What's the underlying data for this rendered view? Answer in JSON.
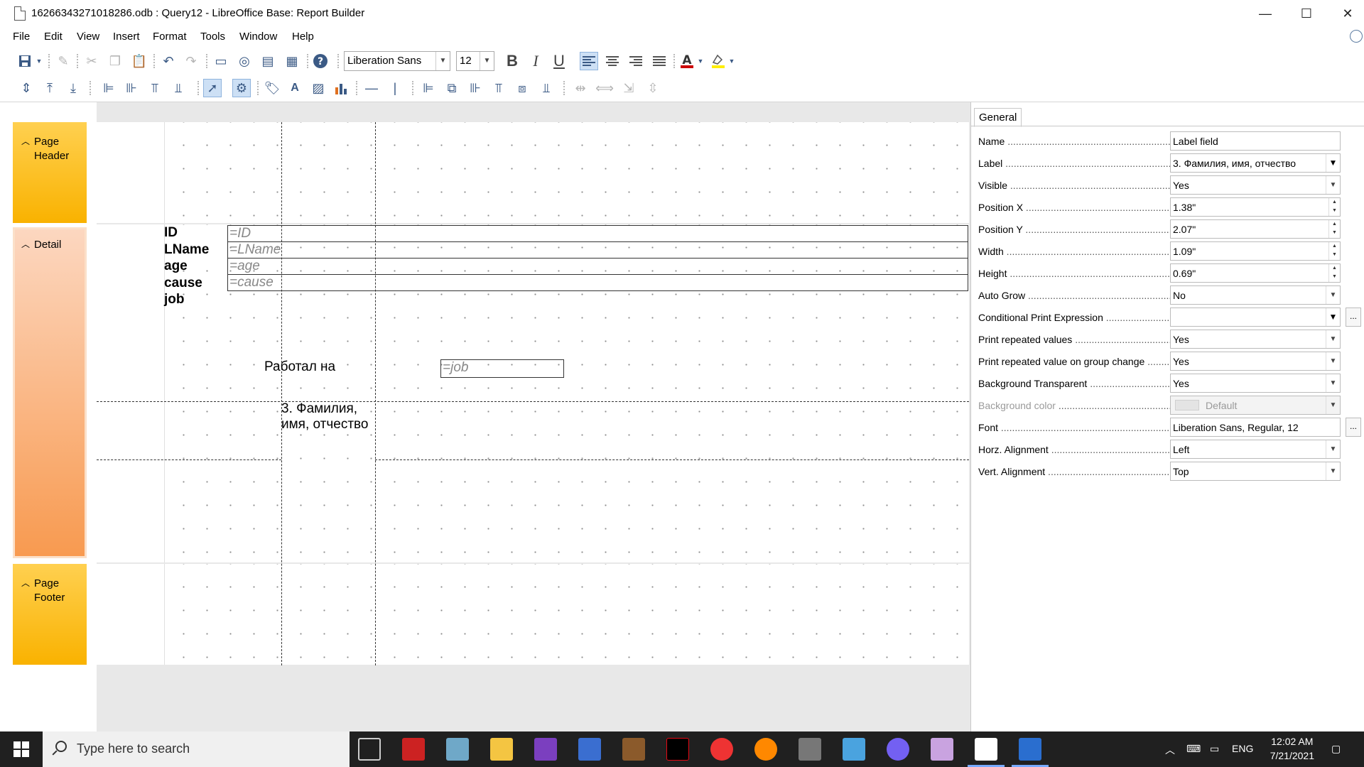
{
  "window": {
    "title": "16266343271018286.odb : Query12 - LibreOffice Base: Report Builder",
    "minimize": "—",
    "maximize": "☐",
    "close": "✕"
  },
  "menu": [
    "File",
    "Edit",
    "View",
    "Insert",
    "Format",
    "Tools",
    "Window",
    "Help"
  ],
  "toolbar": {
    "font_name": "Liberation Sans",
    "font_size": "12",
    "bold": "B",
    "italic": "I",
    "underline": "U",
    "font_color": "#cc0000",
    "highlight_color": "#ffee00"
  },
  "sections": {
    "page_header": [
      "Page",
      "Header"
    ],
    "detail": "Detail",
    "page_footer": [
      "Page",
      "Footer"
    ],
    "colors": {
      "header_top": "#ffd050",
      "header_bottom": "#f9b200",
      "detail_top": "#fcd7c0",
      "detail_bottom": "#f89a50"
    }
  },
  "report": {
    "labels": [
      "ID",
      "LName",
      "age",
      "cause",
      "job"
    ],
    "fields": [
      "=ID",
      "=LName",
      "=age",
      "=cause"
    ],
    "worked_label": "Работал на",
    "job_field": "=job",
    "selected_label": [
      "3. Фамилия,",
      "имя, отчество"
    ]
  },
  "properties": {
    "tab": "General",
    "rows": [
      {
        "name": "Name",
        "value": "Label field",
        "kind": "text"
      },
      {
        "name": "Label",
        "value": "3. Фамилия, имя, отчество",
        "kind": "dropdown-solid"
      },
      {
        "name": "Visible",
        "value": "Yes",
        "kind": "dropdown"
      },
      {
        "name": "Position X",
        "value": "1.38\"",
        "kind": "spin"
      },
      {
        "name": "Position Y",
        "value": "2.07\"",
        "kind": "spin"
      },
      {
        "name": "Width",
        "value": "1.09\"",
        "kind": "spin"
      },
      {
        "name": "Height",
        "value": "0.69\"",
        "kind": "spin"
      },
      {
        "name": "Auto Grow",
        "value": "No",
        "kind": "dropdown"
      },
      {
        "name": "Conditional Print Expression",
        "value": "",
        "kind": "dropdown-solid-btn"
      },
      {
        "name": "Print repeated values",
        "value": "Yes",
        "kind": "dropdown"
      },
      {
        "name": "Print repeated value on group change",
        "value": "Yes",
        "kind": "dropdown"
      },
      {
        "name": "Background Transparent",
        "value": "Yes",
        "kind": "dropdown"
      },
      {
        "name": "Background color",
        "value": "Default",
        "kind": "disabled"
      },
      {
        "name": "Font",
        "value": "Liberation Sans, Regular, 12",
        "kind": "text-btn"
      },
      {
        "name": "Horz. Alignment",
        "value": "Left",
        "kind": "dropdown"
      },
      {
        "name": "Vert. Alignment",
        "value": "Top",
        "kind": "dropdown"
      }
    ]
  },
  "taskbar": {
    "search_placeholder": "Type here to search",
    "language": "ENG",
    "time": "12:02 AM",
    "date": "7/21/2021"
  }
}
